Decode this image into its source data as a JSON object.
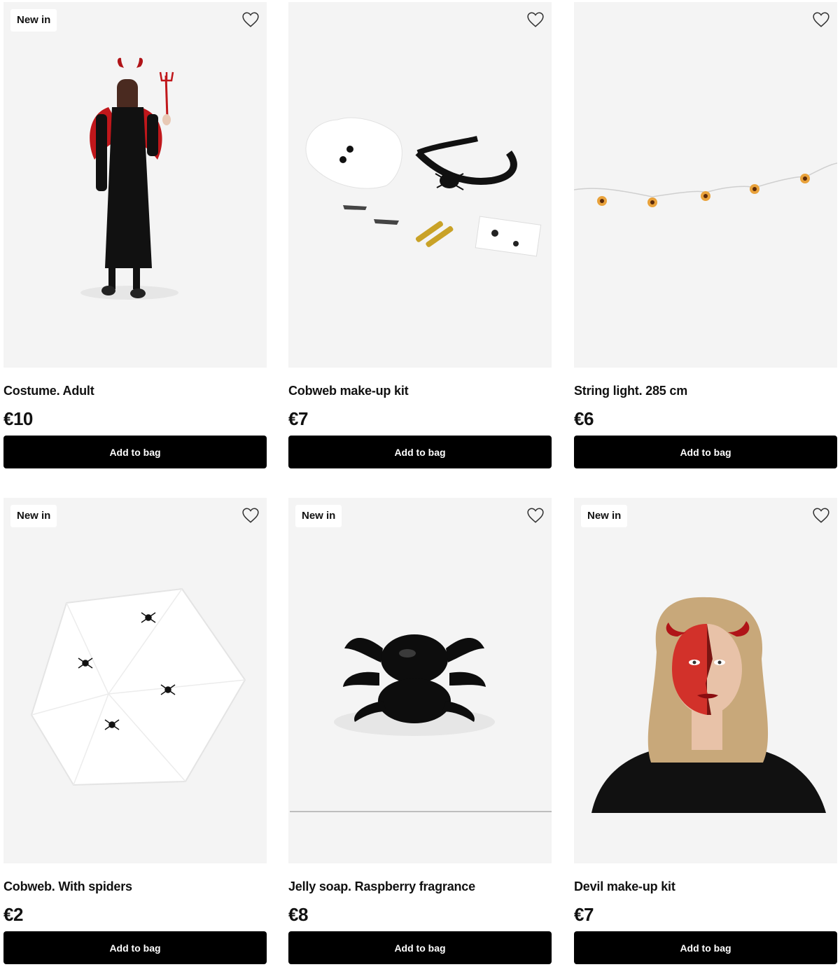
{
  "products": [
    {
      "badge": "New in",
      "title": "Costume. Adult",
      "price": "€10",
      "button": "Add to bag"
    },
    {
      "badge": "",
      "title": "Cobweb make-up kit",
      "price": "€7",
      "button": "Add to bag"
    },
    {
      "badge": "",
      "title": "String light. 285 cm",
      "price": "€6",
      "button": "Add to bag"
    },
    {
      "badge": "New in",
      "title": "Cobweb. With spiders",
      "price": "€2",
      "button": "Add to bag"
    },
    {
      "badge": "New in",
      "title": "Jelly soap. Raspberry fragrance",
      "price": "€8",
      "button": "Add to bag"
    },
    {
      "badge": "New in",
      "title": "Devil make-up kit",
      "price": "€7",
      "button": "Add to bag"
    }
  ],
  "icons": {
    "favourite": "heart-outline-icon"
  },
  "colors": {
    "button_bg": "#000000",
    "button_text": "#ffffff",
    "image_bg": "#f4f4f4",
    "badge_bg": "#ffffff"
  }
}
